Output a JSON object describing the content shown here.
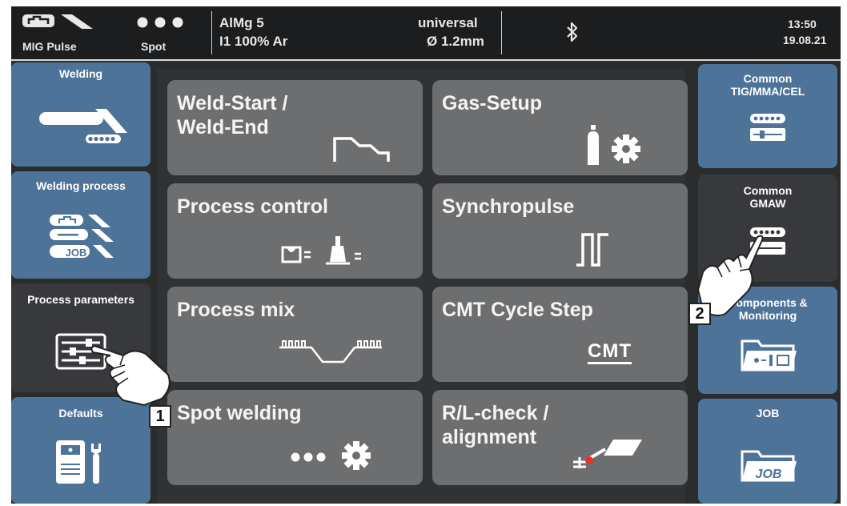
{
  "topbar": {
    "mode": "MIG Pulse",
    "spot": "Spot",
    "material": "AlMg 5",
    "gas": "I1 100% Ar",
    "wire_type": "universal",
    "wire_diameter": "Ø 1.2mm",
    "time": "13:50",
    "date": "19.08.21",
    "bluetooth_icon": "bluetooth-icon"
  },
  "left_sidebar": [
    {
      "label": "Welding",
      "icon": "welding-torch-icon",
      "state": "active"
    },
    {
      "label": "Welding process",
      "icon": "welding-process-icon",
      "badge": "JOB",
      "state": "active"
    },
    {
      "label": "Process parameters",
      "icon": "parameters-sliders-icon",
      "state": "selected"
    },
    {
      "label": "Defaults",
      "icon": "defaults-machine-wrench-icon",
      "state": "active"
    }
  ],
  "right_sidebar": [
    {
      "label": "Common TIG/MMA/CEL",
      "icon": "common-settings-icon",
      "state": "active"
    },
    {
      "label": "Common GMAW",
      "icon": "common-settings-icon",
      "state": "selected"
    },
    {
      "label": "Components & Monitoring",
      "icon": "components-folder-icon",
      "state": "active"
    },
    {
      "label": "JOB",
      "icon": "job-folder-icon",
      "folder_text": "JOB",
      "state": "active"
    }
  ],
  "tiles": [
    {
      "label": "Weld-Start /\nWeld-End",
      "icon": "weld-start-end-icon"
    },
    {
      "label": "Gas-Setup",
      "icon": "gas-bottle-gear-icon"
    },
    {
      "label": "Process control",
      "icon": "process-control-icon"
    },
    {
      "label": "Synchropulse",
      "icon": "synchropulse-icon"
    },
    {
      "label": "Process mix",
      "icon": "process-mix-icon"
    },
    {
      "label": "CMT Cycle Step",
      "icon": "cmt-icon",
      "icon_text": "CMT"
    },
    {
      "label": "Spot welding",
      "icon": "spot-welding-gear-icon"
    },
    {
      "label": "R/L-check /\nalignment",
      "icon": "rl-check-icon"
    }
  ],
  "callouts": [
    "1",
    "2"
  ],
  "colors": {
    "sidebar_blue": "#4e7399",
    "sidebar_dark": "#37393c",
    "tile_gray": "#6d6e70",
    "background": "#2a2c2e",
    "topbar": "#1c1d1f"
  }
}
